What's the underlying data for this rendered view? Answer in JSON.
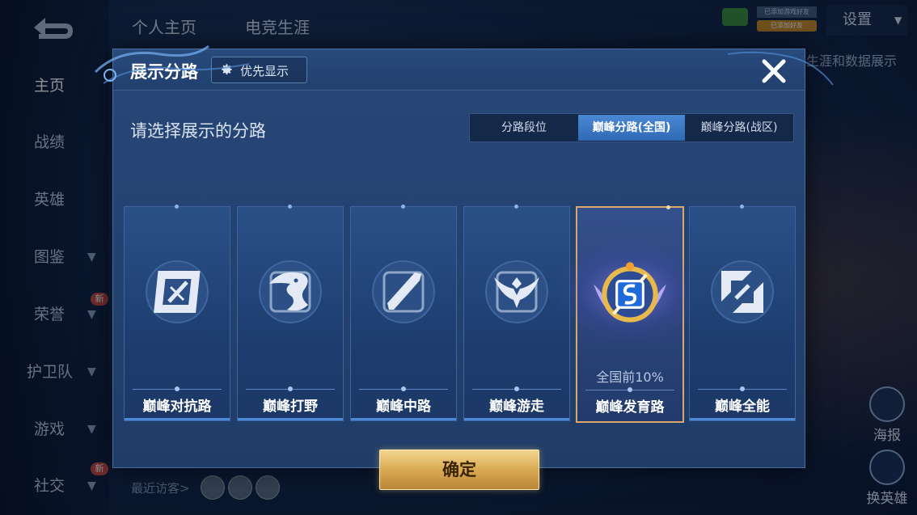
{
  "background": {
    "top_tabs": [
      "个人主页",
      "电竞生涯"
    ],
    "settings_label": "设置",
    "tag_small_1": "已添加游戏好友",
    "tag_small_2": "已添加好友",
    "caption": "生涯和数据展示",
    "nav": [
      {
        "label": "主页",
        "active": true
      },
      {
        "label": "战绩"
      },
      {
        "label": "英雄"
      },
      {
        "label": "图鉴",
        "chevron": true
      },
      {
        "label": "荣誉",
        "chevron": true,
        "badge": "新"
      },
      {
        "label": "护卫队",
        "chevron": true
      },
      {
        "label": "游戏",
        "chevron": true
      },
      {
        "label": "社交",
        "chevron": true,
        "badge": "新"
      }
    ],
    "side_buttons": [
      "海报",
      "换英雄"
    ],
    "visitors_label": "最近访客>"
  },
  "modal": {
    "title": "展示分路",
    "priority_label": "优先显示",
    "prompt": "请选择展示的分路",
    "segments": [
      {
        "label": "分路段位",
        "active": false
      },
      {
        "label": "巅峰分路(全国)",
        "active": true
      },
      {
        "label": "巅峰分路(战区)",
        "active": false
      }
    ],
    "roles": [
      {
        "name": "巅峰对抗路",
        "icon": "clash-lane-icon"
      },
      {
        "name": "巅峰打野",
        "icon": "jungle-dragon-icon"
      },
      {
        "name": "巅峰中路",
        "icon": "mid-lane-icon"
      },
      {
        "name": "巅峰游走",
        "icon": "roam-wings-icon"
      },
      {
        "name": "巅峰发育路",
        "icon": "farm-lane-badge-icon",
        "selected": true,
        "rank": "全国前10%"
      },
      {
        "name": "巅峰全能",
        "icon": "all-round-icon"
      }
    ],
    "confirm_label": "确定"
  },
  "colors": {
    "accent_blue": "#2f69b6",
    "gold": "#d9aa53",
    "selected_border": "#d9a86a"
  }
}
